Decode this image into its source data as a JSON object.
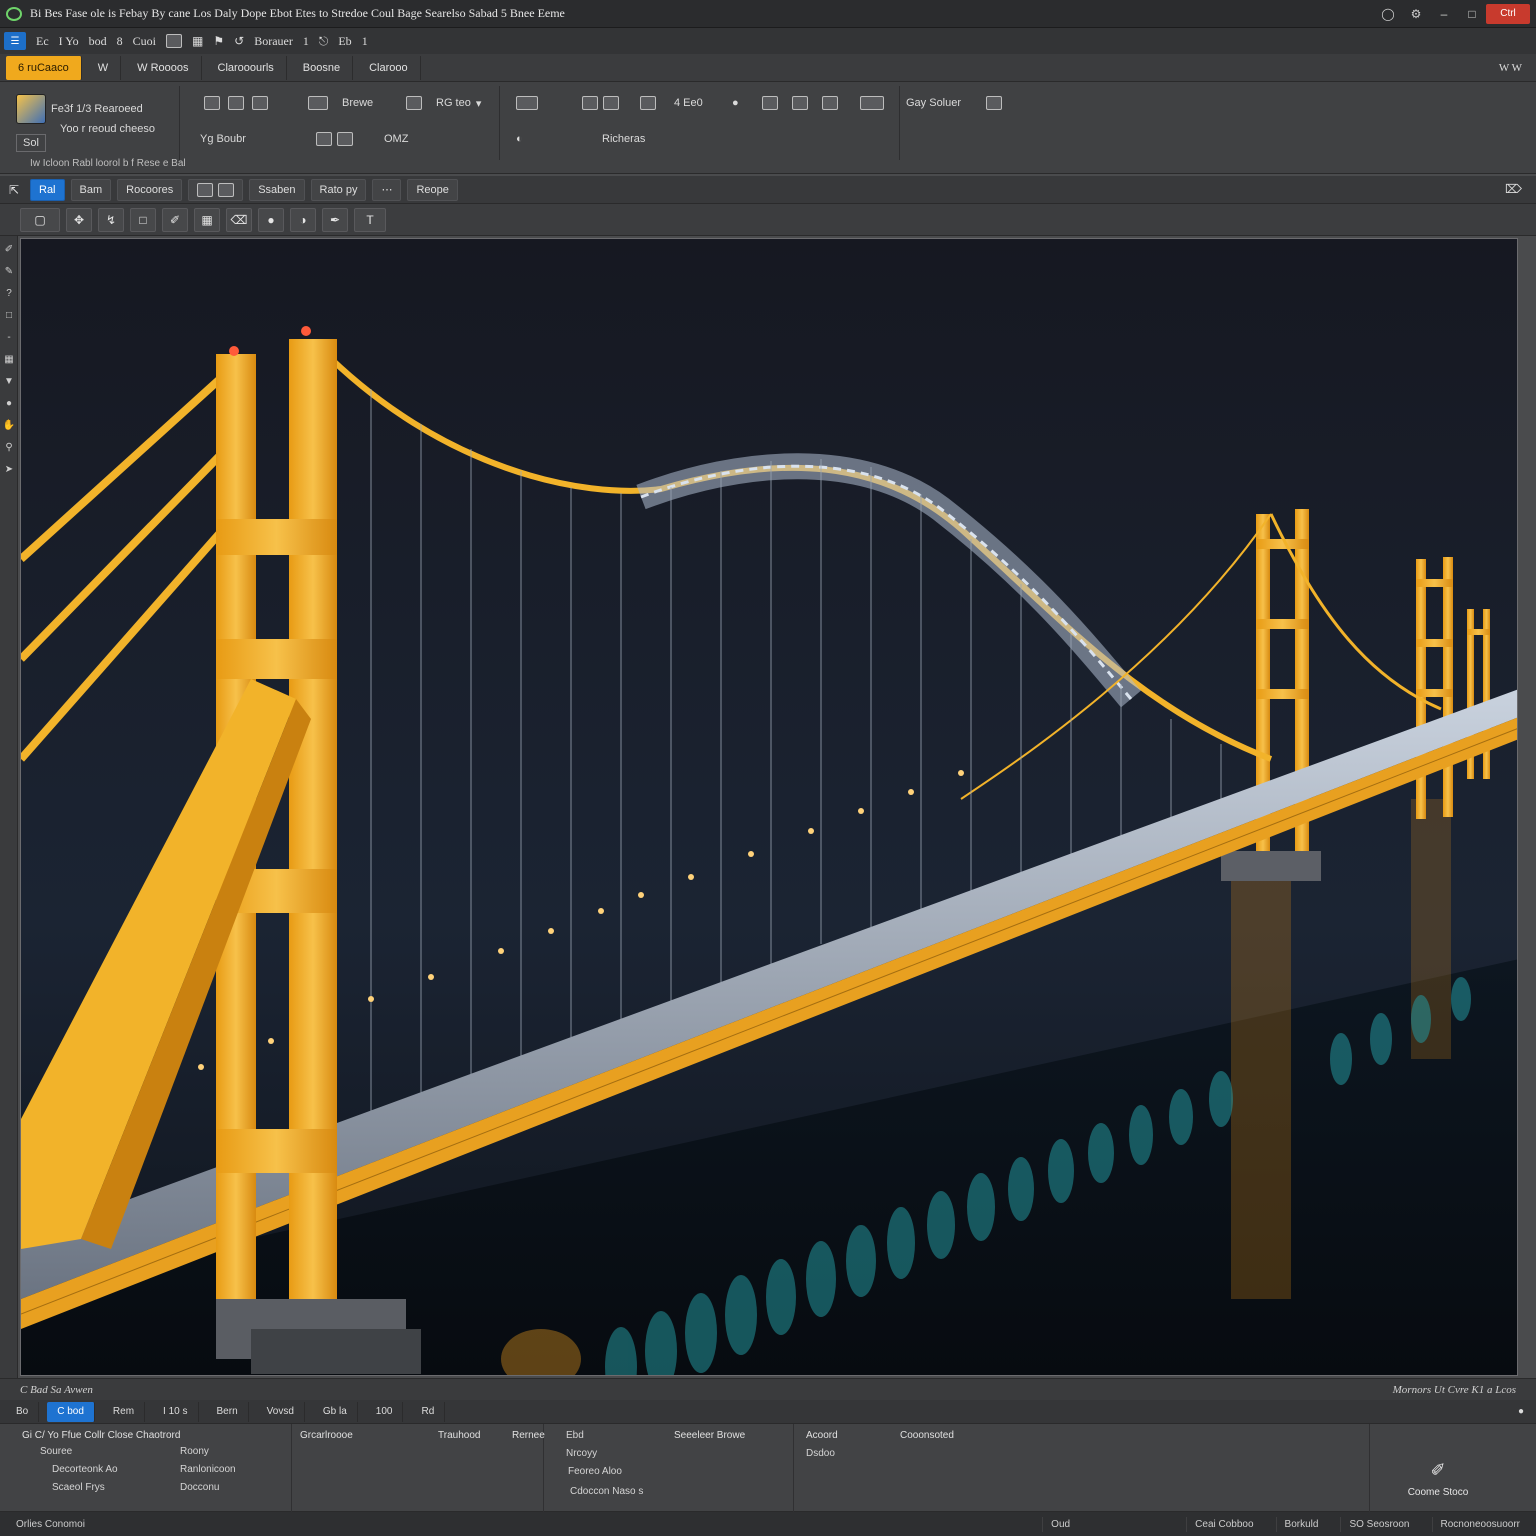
{
  "titlebar": {
    "title": "Bi Bes Fase ole is Febay By cane Los Daly Dope Ebot Etes to Stredoe Coul Bage Searelso Sabad 5 Bnee Eeme",
    "close_label": "Ctrl"
  },
  "qat": {
    "items": [
      "Ec",
      "I Yo",
      "bod",
      "8",
      "Cuoi",
      "Borauer",
      "1",
      "Eb",
      "1"
    ]
  },
  "tabs": [
    "6 ruCaaco",
    "W",
    "W Roooos",
    "Clarooourls",
    "Boosne",
    "Clarooo"
  ],
  "tabs_right": "W W",
  "ribbon": {
    "file_title": "Fe3f 1/3 Rearoeed",
    "file_sub": "Yoo r reoud cheeso",
    "file_btn": "Sol",
    "b1": "Brewe",
    "b2": "RG teo",
    "b3": "4 Ee0",
    "b4": "Gay Soluer",
    "r2a": "Yg Boubr",
    "r2b": "OMZ",
    "r2c": "Richeras",
    "footer": "Iw Icloon    Rabl loorol b f Rese e Bal"
  },
  "toolbar2": [
    "Ral",
    "Bam",
    "Rocoores",
    "Ssaben",
    "Rato py",
    "Reope"
  ],
  "status": {
    "left": "C Bad Sa Avwen",
    "right": "Mornors Ut Cvre K1 a Lcos"
  },
  "bottomtabs": [
    "Bo",
    "C bod",
    "Rem",
    "I 10 s",
    "Bern",
    "Vovsd",
    "Gb la",
    "100",
    "Rd"
  ],
  "props": {
    "col1_head": "Gi C/ Yo Ffue Collr Close Chaotrord",
    "col1_rows": [
      "Souree",
      "Roony",
      "Decorteonk Ao",
      "Ranlonicoon",
      "Scaeol Frys",
      "Docconu"
    ],
    "col2_head": "Grcarlroooe",
    "col3_head": "Trauhood",
    "col3_b": "Rernee",
    "col3_rows": [
      "Ebd",
      "Nrcoyy",
      "Feoreo Aloo",
      "Cdoccon Naso s"
    ],
    "col3_c": "Seeeleer Browe",
    "col4_head": "Acoord",
    "col4_b": "Dsdoo",
    "col4_c": "Cooonsoted",
    "ok_label": "Coome Stoco"
  },
  "statusbar": {
    "left": "Orlies Conomoi",
    "mid": "Oud",
    "items": [
      "Ceai Cobboo",
      "Borkuld",
      "SO Seosroon",
      "Rocnoneoosuoorr"
    ]
  },
  "colors": {
    "accent": "#f0a91d",
    "selection": "#1e73d1",
    "bridge": "#f2b32a",
    "sky": "#1a1d26"
  }
}
